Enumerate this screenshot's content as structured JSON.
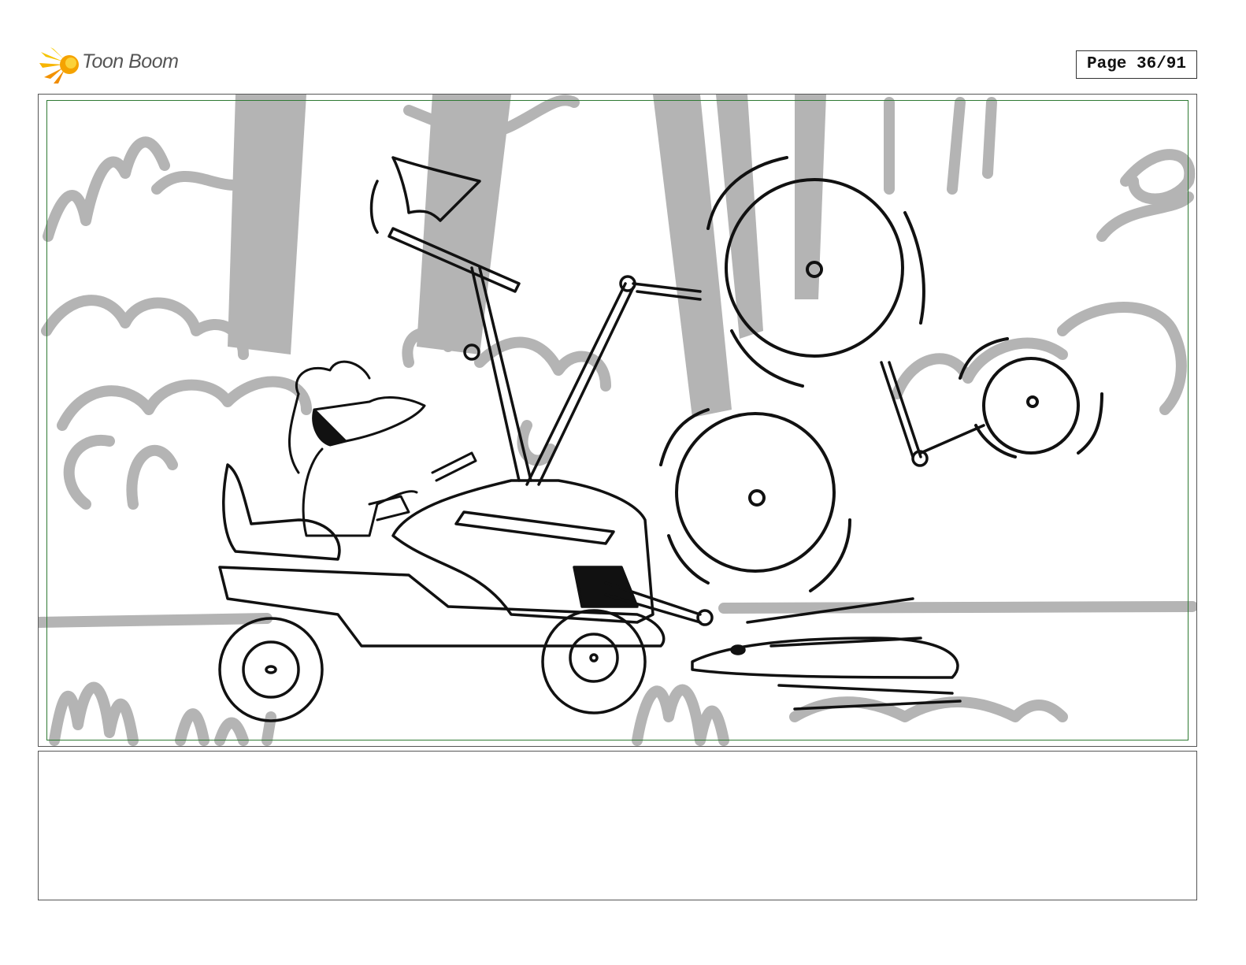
{
  "header": {
    "brand_name": "Toon Boom",
    "brand_icon": "starburst-logo-icon",
    "page_indicator": "Page 36/91"
  },
  "panel": {
    "safe_frame_color": "#2f7a33",
    "background_sketch_color": "#b4b4b4",
    "line_art_color": "#111111",
    "icons": [
      "tractor-mower-drawing",
      "rider-character-drawing",
      "axe-arm-drawing",
      "spinning-blade-drawing"
    ]
  },
  "notes": {
    "text": ""
  },
  "colors": {
    "logo_yellow": "#f5c400",
    "logo_orange": "#f39200",
    "logo_text": "#555555"
  }
}
